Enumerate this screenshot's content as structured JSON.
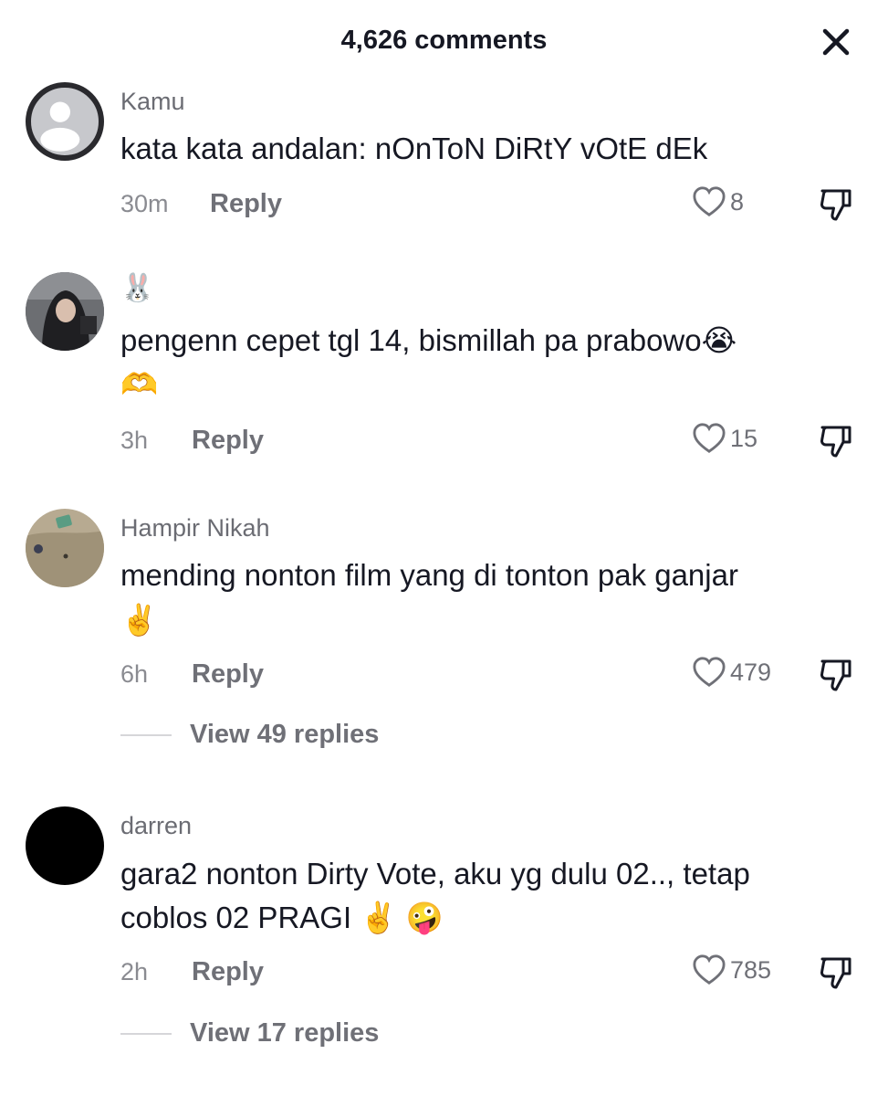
{
  "header": {
    "title": "4,626 comments",
    "close_icon": "close-icon"
  },
  "comments": [
    {
      "username": "Kamu",
      "text_line1": "kata kata andalan: nOnToN DiRtY vOtE dEk",
      "text_line2": "",
      "time": "30m",
      "reply_label": "Reply",
      "likes": "8",
      "avatar": "default-avatar-icon"
    },
    {
      "username": "🐰",
      "text_line1": "pengenn cepet tgl 14, bismillah pa prabowo😭",
      "text_line2": "🫶",
      "time": "3h",
      "reply_label": "Reply",
      "likes": "15",
      "avatar": "hijab-girl-photo"
    },
    {
      "username": "Hampir Nikah",
      "text_line1": "mending nonton film yang di tonton pak ganjar",
      "text_line2": "✌️",
      "time": "6h",
      "reply_label": "Reply",
      "likes": "479",
      "view_replies": "View 49 replies",
      "avatar": "couch-photo"
    },
    {
      "username": "darren",
      "text_line1": "gara2 nonton Dirty Vote, aku yg dulu 02.., tetap",
      "text_line2": "coblos 02 PRAGI ✌️ 🤪",
      "time": "2h",
      "reply_label": "Reply",
      "likes": "785",
      "view_replies": "View 17 replies",
      "avatar": "black-avatar"
    }
  ],
  "colors": {
    "text": "#161823",
    "secondary": "#6f7077",
    "muted": "#8a8b91"
  }
}
